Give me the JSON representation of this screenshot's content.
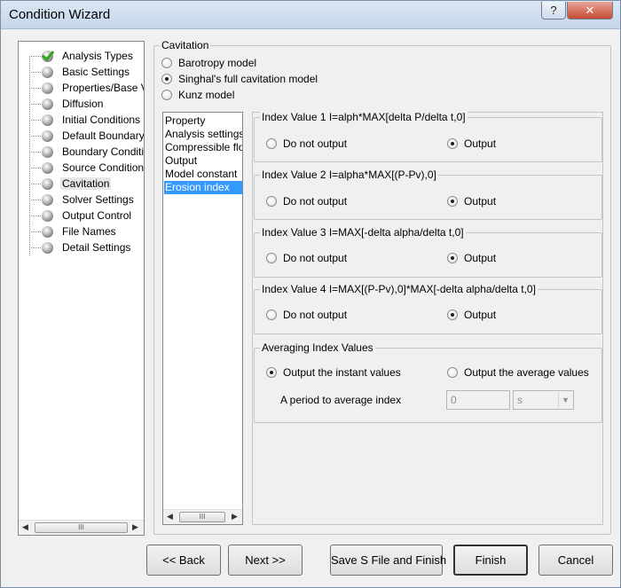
{
  "window": {
    "title": "Condition Wizard"
  },
  "titlebar": {
    "help": "?",
    "close": "✕"
  },
  "tree": {
    "items": [
      {
        "label": "Analysis Types",
        "checked": true
      },
      {
        "label": "Basic Settings"
      },
      {
        "label": "Properties/Base V"
      },
      {
        "label": "Diffusion"
      },
      {
        "label": "Initial Conditions"
      },
      {
        "label": "Default Boundary"
      },
      {
        "label": "Boundary Conditic"
      },
      {
        "label": "Source Conditions"
      },
      {
        "label": "Cavitation",
        "selected": true
      },
      {
        "label": "Solver Settings"
      },
      {
        "label": "Output Control"
      },
      {
        "label": "File Names"
      },
      {
        "label": "Detail Settings"
      }
    ],
    "scroll_left": "◀",
    "scroll_right": "▶",
    "thumb_grip": "III"
  },
  "cavitation": {
    "group_label": "Cavitation",
    "models": [
      {
        "label": "Barotropy model",
        "selected": false
      },
      {
        "label": "Singhal's full cavitation model",
        "selected": true
      },
      {
        "label": "Kunz model",
        "selected": false
      }
    ]
  },
  "settings_list": {
    "items": [
      {
        "label": "Property"
      },
      {
        "label": "Analysis settings"
      },
      {
        "label": "Compressible flow"
      },
      {
        "label": "Output"
      },
      {
        "label": "Model constant"
      },
      {
        "label": "Erosion index",
        "selected": true
      }
    ],
    "scroll_left": "◀",
    "scroll_right": "▶",
    "thumb_grip": "III"
  },
  "index_groups": [
    {
      "label": "Index Value 1 I=alph*MAX[delta P/delta t,0]",
      "no_output": "Do not output",
      "output": "Output",
      "selected": "output"
    },
    {
      "label": "Index Value 2 I=alpha*MAX[(P-Pv),0]",
      "no_output": "Do not output",
      "output": "Output",
      "selected": "output"
    },
    {
      "label": "Index Value 3 I=MAX[-delta alpha/delta t,0]",
      "no_output": "Do not output",
      "output": "Output",
      "selected": "output"
    },
    {
      "label": "Index Value 4 I=MAX[(P-Pv),0]*MAX[-delta alpha/delta t,0]",
      "no_output": "Do not output",
      "output": "Output",
      "selected": "output"
    }
  ],
  "averaging": {
    "group_label": "Averaging Index Values",
    "instant_label": "Output the instant values",
    "average_label": "Output the average values",
    "selected": "instant",
    "period_label": "A period to average index",
    "period_value": "0",
    "unit_value": "s",
    "unit_dropdown": "▼"
  },
  "buttons": {
    "back": "<< Back",
    "next": "Next >>",
    "save": "Save S File and Finish",
    "finish": "Finish",
    "cancel": "Cancel"
  }
}
